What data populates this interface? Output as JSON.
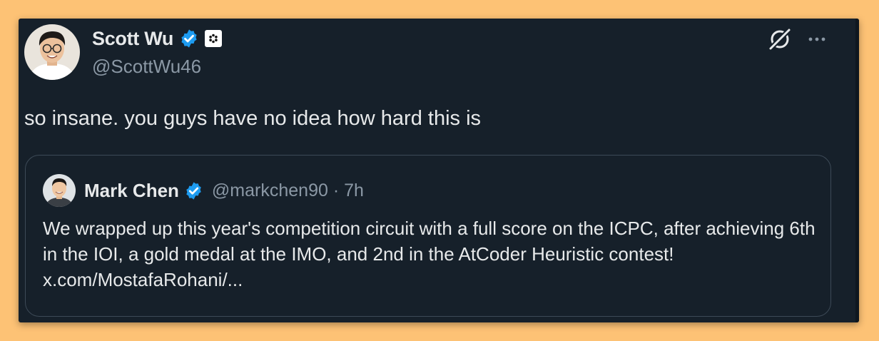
{
  "author": {
    "name": "Scott Wu",
    "handle": "@ScottWu46",
    "verified": true
  },
  "tweet": {
    "text": "so insane. you guys have no idea how hard this is"
  },
  "quoted": {
    "name": "Mark Chen",
    "verified": true,
    "meta": "@markchen90 · 7h",
    "text": "We wrapped up this year's competition circuit with a full score on the ICPC, after achieving 6th in the IOI, a gold medal at the IMO, and 2nd in the AtCoder Heuristic contest! x.com/MostafaRohani/..."
  },
  "icons": {
    "verified": "verified-badge-icon",
    "affiliate": "affiliate-badge-icon",
    "grok": "grok-icon",
    "more": "more-options-icon"
  },
  "colors": {
    "background": "#FDC275",
    "card": "#16202A",
    "text": "#E7E9EA",
    "secondary_text": "#8B98A5",
    "verified_blue": "#1D9BF0"
  }
}
